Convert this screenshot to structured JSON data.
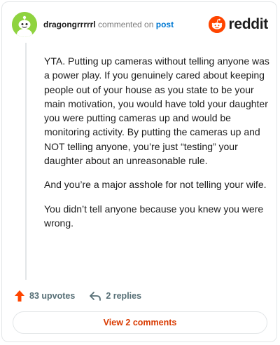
{
  "header": {
    "username": "dragongrrrrrl",
    "action_text": "commented on",
    "target_link": "post",
    "brand": "reddit"
  },
  "comment": {
    "paragraphs": [
      "YTA. Putting up cameras without telling anyone was a power play. If you genuinely cared about keeping people out of your house as you state to be your main motivation, you would have told your daughter you were putting cameras up and would be monitoring activity. By putting the cameras up and NOT telling anyone, you’re just “testing” your daughter about an unreasonable rule.",
      "And you’re a major asshole for not telling your wife.",
      "You didn’t tell anyone because you knew you were wrong."
    ]
  },
  "actions": {
    "upvotes_label": "83 upvotes",
    "replies_label": "2 replies"
  },
  "footer": {
    "view_comments_label": "View 2 comments"
  },
  "colors": {
    "brand_orange": "#ff4500",
    "link_blue": "#0079d3",
    "button_text": "#d93a00",
    "avatar_green": "#8fd33f"
  },
  "icons": {
    "avatar": "snoo-avatar-icon",
    "brand": "reddit-logo-icon",
    "upvote": "upvote-arrow-icon",
    "reply": "reply-arrow-icon"
  }
}
